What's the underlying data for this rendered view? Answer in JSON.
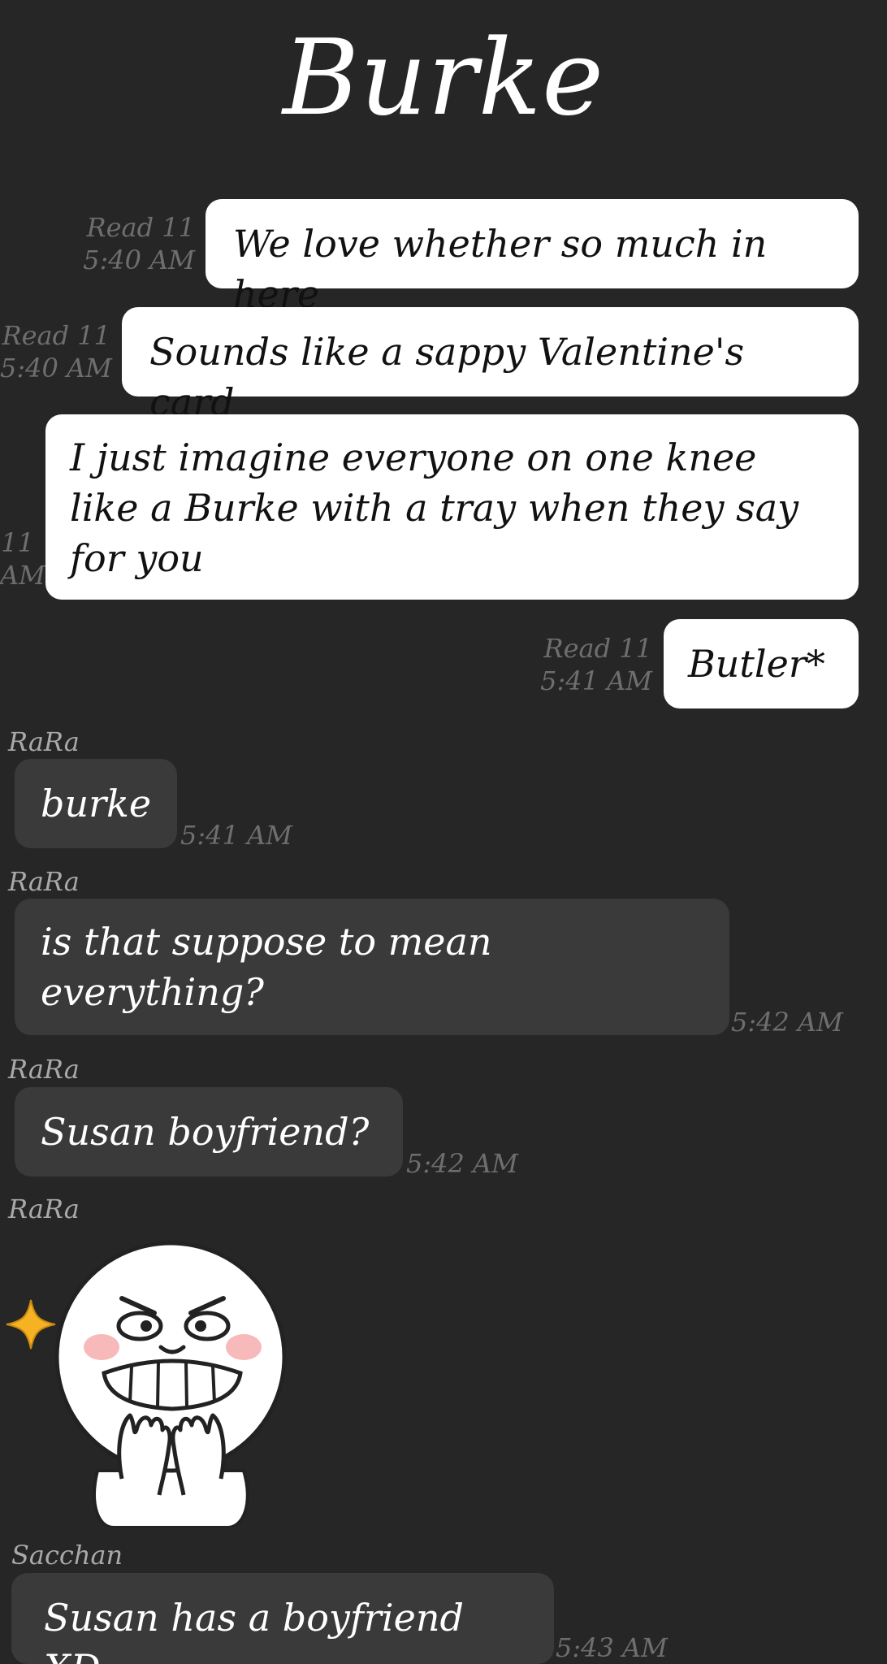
{
  "header": {
    "title": "Burke"
  },
  "messages": [
    {
      "type": "outgoing",
      "status": "Read 11",
      "time": "5:40 AM",
      "lines": [
        "We love whether so much in here"
      ]
    },
    {
      "type": "outgoing",
      "status": "Read 11",
      "time": "5:40 AM",
      "lines": [
        "Sounds like a sappy Valentine's card"
      ]
    },
    {
      "type": "outgoing",
      "status": "11",
      "time": "AM",
      "lines": [
        "I just imagine everyone on one knee",
        "like a Burke with a tray when they say",
        "for you"
      ]
    },
    {
      "type": "outgoing",
      "status": "Read 11",
      "time": "5:41 AM",
      "lines": [
        "Butler*"
      ]
    },
    {
      "type": "incoming",
      "sender": "RaRa",
      "time": "5:41 AM",
      "lines": [
        "burke"
      ]
    },
    {
      "type": "incoming",
      "sender": "RaRa",
      "time": "5:42 AM",
      "lines": [
        "is that suppose to mean",
        "everything?"
      ]
    },
    {
      "type": "incoming",
      "sender": "RaRa",
      "time": "5:42 AM",
      "lines": [
        "Susan boyfriend?"
      ]
    },
    {
      "type": "incoming-sticker",
      "sender": "RaRa",
      "sticker": "grinning-moon-face-sticker"
    },
    {
      "type": "incoming",
      "sender": "Sacchan",
      "time": "5:43 AM",
      "lines": [
        "Susan has a boyfriend XD"
      ]
    }
  ],
  "colors": {
    "background": "#262626",
    "outgoing_bubble": "#ffffff",
    "incoming_bubble": "#3a3a3a",
    "meta_text": "#6e6e6e",
    "sender_text": "#a9a9a9",
    "sparkle": "#f5b324"
  }
}
